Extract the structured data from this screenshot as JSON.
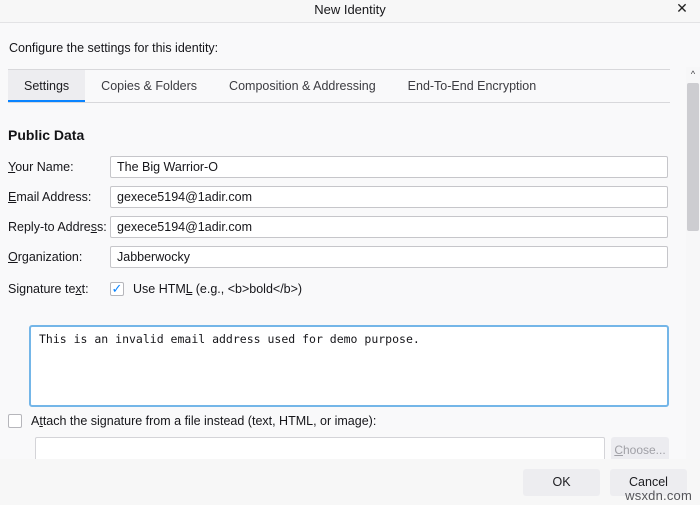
{
  "window": {
    "title": "New Identity",
    "close_icon": "close-icon"
  },
  "intro": {
    "text": "Configure the settings for this identity:"
  },
  "tabs": [
    {
      "label": "Settings",
      "active": true
    },
    {
      "label": "Copies & Folders",
      "active": false
    },
    {
      "label": "Composition & Addressing",
      "active": false
    },
    {
      "label": "End-To-End Encryption",
      "active": false
    }
  ],
  "section": {
    "title": "Public Data"
  },
  "fields": [
    {
      "label_pre": "",
      "label_key": "Y",
      "label_post": "our Name:",
      "value": "The Big Warrior-O"
    },
    {
      "label_pre": "",
      "label_key": "E",
      "label_post": "mail Address:",
      "value": "gexece5194@1adir.com"
    },
    {
      "label_pre": "Reply-to Addre",
      "label_key": "s",
      "label_post": "s:",
      "value": "gexece5194@1adir.com"
    },
    {
      "label_pre": "",
      "label_key": "O",
      "label_post": "rganization:",
      "value": "Jabberwocky"
    }
  ],
  "signature": {
    "row_label": "Signature te",
    "row_label_key": "x",
    "row_label_post": "t:",
    "use_html_checkbox": {
      "checked": true,
      "checkmark": "✓",
      "label_pre": "Use HTM",
      "label_key": "L",
      "label_post": " (e.g., <b>bold</b>)"
    },
    "text": "This is an invalid email address used for demo purpose."
  },
  "attach": {
    "checkbox_checked": false,
    "label_pre": "A",
    "label_key": "t",
    "label_post": "tach the signature from a file instead (text, HTML, or image):",
    "file_value": "",
    "file_placeholder": "",
    "choose_label_pre": "",
    "choose_label_key": "C",
    "choose_label_post": "hoose..."
  },
  "clipped_row": {
    "text": ""
  },
  "scrollbar": {
    "up_arrow": "⌃",
    "down_arrow": "⌄"
  },
  "footer": {
    "ok_label": "OK",
    "cancel_label": "Cancel"
  },
  "watermark": {
    "text": "wsxdn.com"
  },
  "colors": {
    "accent": "#0a84ff",
    "focus_border": "#74b6e8",
    "dialog_bg": "#f9f9fa",
    "button_bg": "#ededf0"
  }
}
